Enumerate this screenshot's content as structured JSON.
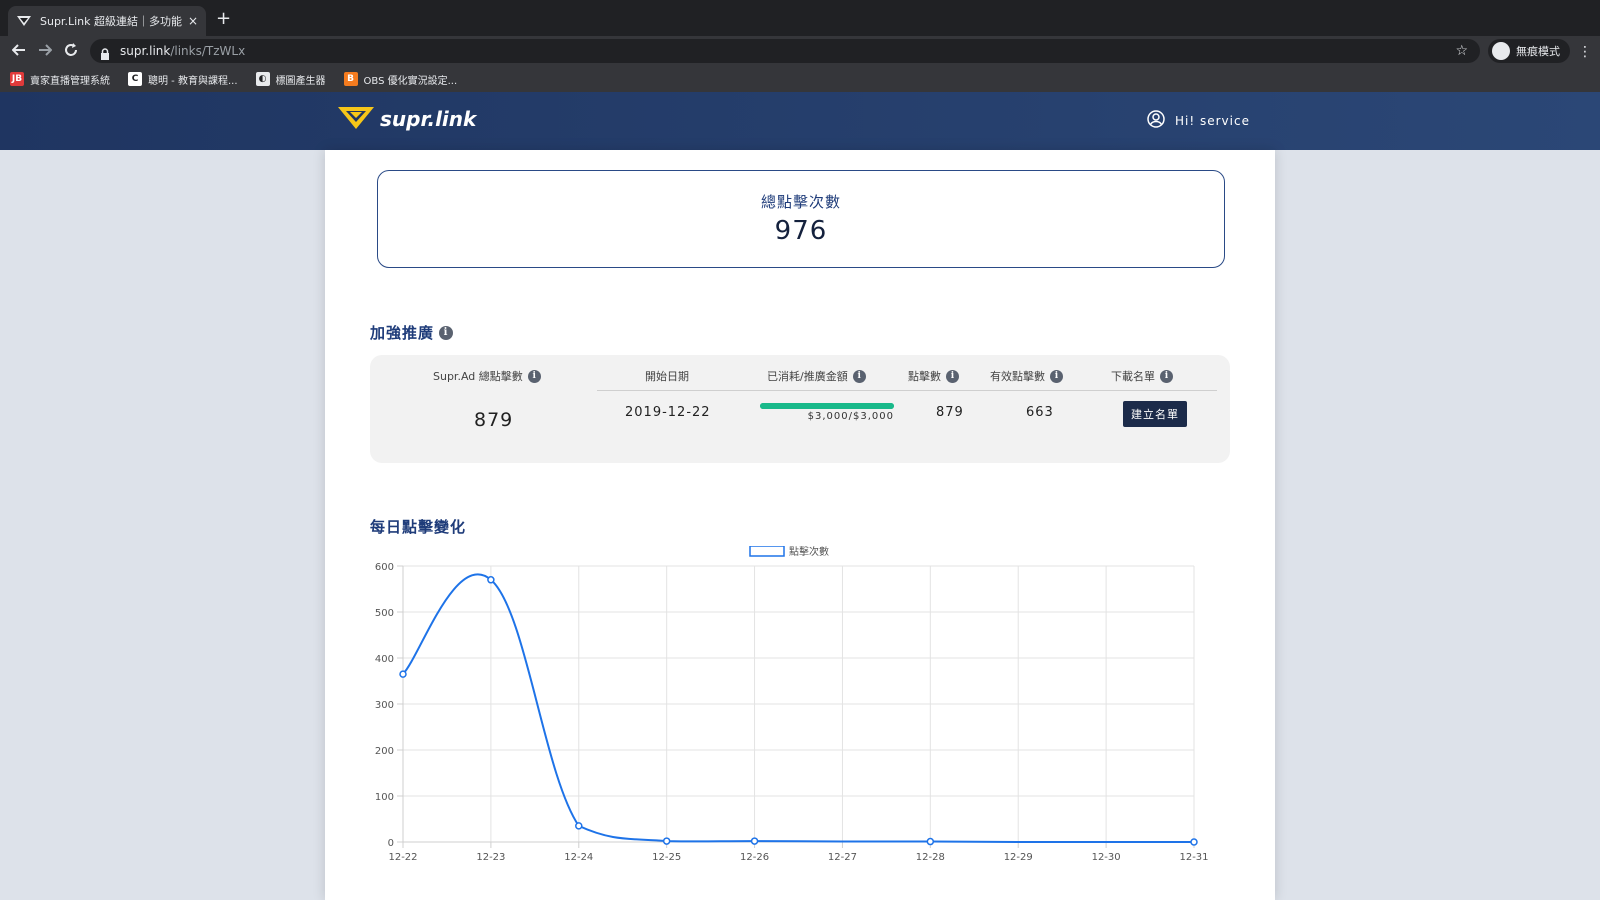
{
  "browser": {
    "tab_title": "Supr.Link 超級連結｜多功能縮",
    "tab_close": "×",
    "new_tab": "+",
    "url_host": "supr.link",
    "url_path": "/links/TzWLx",
    "incognito_label": "無痕模式",
    "bookmarks": [
      {
        "label": "賣家直播管理系統",
        "icon": "JB",
        "color": "#e03a3a"
      },
      {
        "label": "聰明 - 教育與課程...",
        "icon": "C",
        "color": "#ffffff"
      },
      {
        "label": "標圖產生器",
        "icon": "◐",
        "color": "#e8eaed"
      },
      {
        "label": "OBS 優化實況設定...",
        "icon": "B",
        "color": "#f57c1f"
      }
    ]
  },
  "header": {
    "logo_text": "supr.link",
    "user_greeting": "Hi! service"
  },
  "total": {
    "label": "總點擊次數",
    "value": "976"
  },
  "promo": {
    "title": "加強推廣",
    "headers": {
      "total_clicks": "Supr.Ad 總點擊數",
      "start_date": "開始日期",
      "spent": "已消耗/推廣金額",
      "clicks": "點擊數",
      "valid_clicks": "有效點擊數",
      "download": "下載名單"
    },
    "values": {
      "total_clicks": "879",
      "start_date": "2019-12-22",
      "spent_label": "$3,000/$3,000",
      "spent_fraction": 1.0,
      "clicks": "879",
      "valid_clicks": "663",
      "create_list_label": "建立名單"
    }
  },
  "daily": {
    "title": "每日點擊變化"
  },
  "chart_data": {
    "type": "line",
    "categories": [
      "12-22",
      "12-23",
      "12-24",
      "12-25",
      "12-26",
      "12-27",
      "12-28",
      "12-29",
      "12-30",
      "12-31"
    ],
    "series": [
      {
        "name": "點擊次數",
        "values": [
          365,
          570,
          35,
          2,
          2,
          1,
          1,
          0,
          0,
          0
        ]
      }
    ],
    "point_indices": [
      0,
      1,
      2,
      3,
      4,
      6,
      9
    ],
    "yticks": [
      0,
      100,
      200,
      300,
      400,
      500,
      600
    ],
    "ylim": [
      0,
      600
    ],
    "grid": true,
    "legend": "top-center",
    "line_color": "#1e73e8"
  }
}
